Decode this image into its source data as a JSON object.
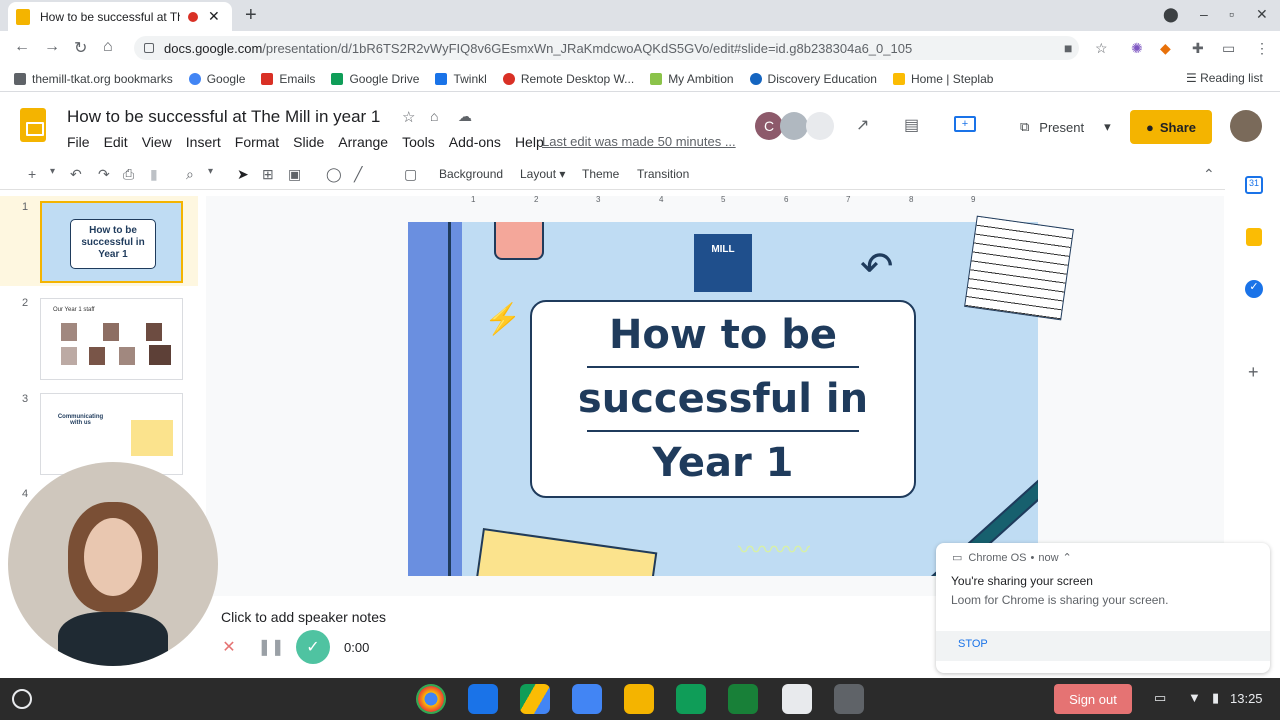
{
  "browser": {
    "tab_title": "How to be successful at The Mill in year 1",
    "tab_title_visible": "How to be successful at Th",
    "url_host": "docs.google.com",
    "url_path": "/presentation/d/1bR6TS2R2vWyFIQ8v6GEsmxWn_JRaKmdcwoAQKdS5GVo/edit#slide=id.g8b238304a6_0_105"
  },
  "bookmarks": [
    {
      "label": "themill-tkat.org bookmarks",
      "color": "#5f6368"
    },
    {
      "label": "Google",
      "color": "#4285f4"
    },
    {
      "label": "Emails",
      "color": "#d93025"
    },
    {
      "label": "Google Drive",
      "color": "#0f9d58"
    },
    {
      "label": "Twinkl",
      "color": "#1a73e8"
    },
    {
      "label": "Remote Desktop W...",
      "color": "#d93025"
    },
    {
      "label": "My Ambition",
      "color": "#8bc34a"
    },
    {
      "label": "Discovery Education",
      "color": "#1565c0"
    },
    {
      "label": "Home | Steplab",
      "color": "#fbbc04"
    }
  ],
  "reading_list": "Reading list",
  "doc": {
    "title": "How to be successful at The Mill in year 1",
    "menus": [
      "File",
      "Edit",
      "View",
      "Insert",
      "Format",
      "Slide",
      "Arrange",
      "Tools",
      "Add-ons",
      "Help"
    ],
    "last_edit": "Last edit was made 50 minutes ...",
    "present_label": "Present",
    "share_label": "Share",
    "collab_initial": "C"
  },
  "toolbar": {
    "background": "Background",
    "layout": "Layout",
    "theme": "Theme",
    "transition": "Transition"
  },
  "ruler": [
    "1",
    "2",
    "3",
    "4",
    "5",
    "6",
    "7",
    "8",
    "9"
  ],
  "filmstrip": {
    "numbers": [
      "1",
      "2",
      "3",
      "4"
    ],
    "thumb1_title": "How to be successful in Year 1",
    "thumb2_title": "Our Year 1 staff",
    "thumb3_title": "Communicating with us"
  },
  "slide": {
    "line1": "How to be",
    "line2": "successful in",
    "line3": "Year 1"
  },
  "speaker_notes": "Click to add speaker notes",
  "loom": {
    "timer": "0:00"
  },
  "notification": {
    "source": "Chrome OS",
    "time": "now",
    "title": "You're sharing your screen",
    "body": "Loom for Chrome is sharing your screen.",
    "action": "STOP"
  },
  "shelf": {
    "sign_out": "Sign out",
    "time": "13:25"
  },
  "colors": {
    "accent": "#f4b400",
    "slide_bg": "#bfdcf3",
    "title_navy": "#1f3b5c"
  }
}
